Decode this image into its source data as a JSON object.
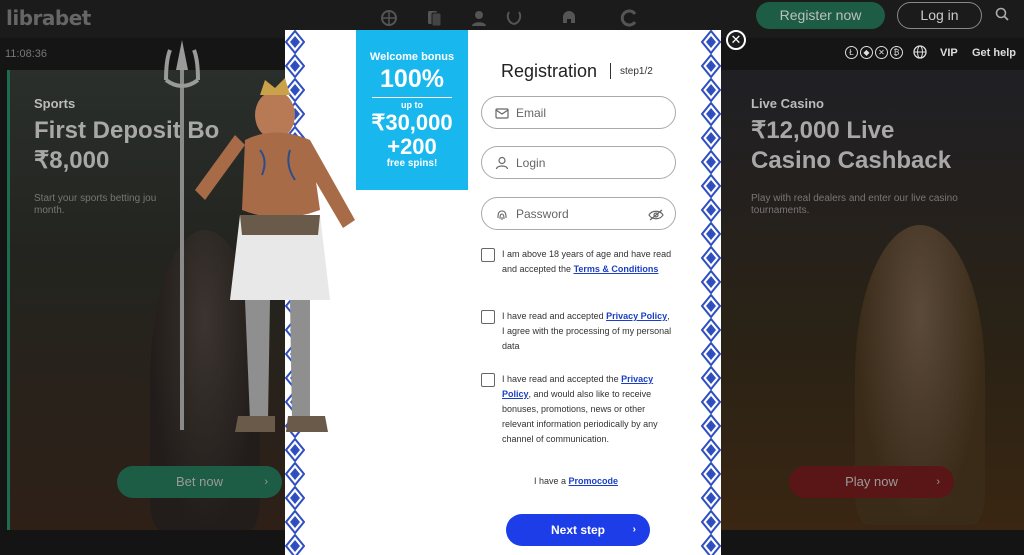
{
  "header": {
    "logo": "librabet",
    "register_label": "Register now",
    "login_label": "Log in"
  },
  "subbar": {
    "time": "11:08:36",
    "vip_label": "VIP",
    "help_label": "Get help"
  },
  "promo_left": {
    "category": "Sports",
    "title_line1": "First Deposit Bo",
    "title_line2": "₹8,000",
    "description_line1": "Start your sports betting jou",
    "description_line2": "month.",
    "button_label": "Bet now"
  },
  "promo_right": {
    "category": "Live Casino",
    "title_line1": "₹12,000 Live",
    "title_line2": "Casino Cashback",
    "description_line1": "Play with real dealers and enter our live casino",
    "description_line2": "tournaments.",
    "button_label": "Play now"
  },
  "bonus": {
    "heading": "Welcome bonus",
    "percent": "100%",
    "upto": "up to",
    "amount": "₹30,000",
    "plus_spins": "+200",
    "spins_label": "free spins!"
  },
  "registration": {
    "title": "Registration",
    "step": "step1/2",
    "email_placeholder": "Email",
    "login_placeholder": "Login",
    "password_placeholder": "Password",
    "checkbox1_pre": "I am above 18 years of age and have read and accepted the ",
    "checkbox1_link": "Terms & Conditions",
    "checkbox2_pre": "I have read and accepted ",
    "checkbox2_link": "Privacy Policy",
    "checkbox2_post": ", I agree with the processing of my personal data",
    "checkbox3_pre": "I have read and accepted the ",
    "checkbox3_link": "Privacy Policy",
    "checkbox3_post": ", and would also like to receive bonuses, promotions, news or other relevant information periodically by any channel of communication.",
    "promocode_pre": "I have a ",
    "promocode_link": "Promocode",
    "next_label": "Next step"
  },
  "colors": {
    "accent_blue": "#1c3de8",
    "bonus_blue": "#18b8ef",
    "brand_green": "#1d5c45"
  }
}
